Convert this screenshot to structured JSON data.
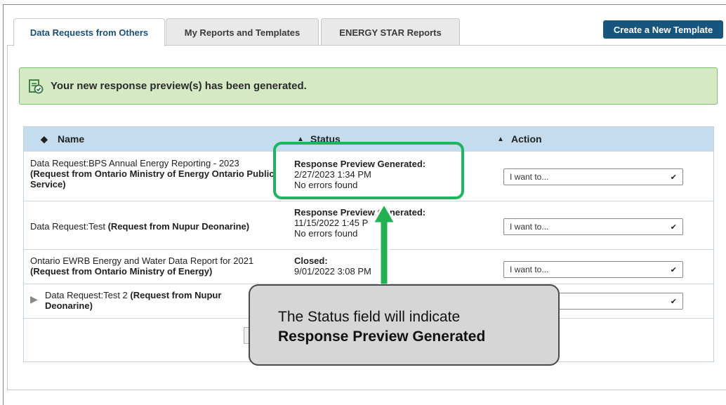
{
  "tabs": [
    {
      "label": "Data Requests from Others"
    },
    {
      "label": "My Reports and Templates"
    },
    {
      "label": "ENERGY STAR Reports"
    }
  ],
  "create_button": "Create a New Template",
  "alert": {
    "text": "Your new response preview(s) has been generated."
  },
  "table": {
    "headers": {
      "name": "Name",
      "status": "Status",
      "action": "Action"
    },
    "rows": [
      {
        "name_plain": "Data Request:BPS Annual Energy Reporting - 2023",
        "name_bold": "(Request from Ontario Ministry of Energy Ontario Public Service)",
        "status_title": "Response Preview Generated:",
        "status_date": "2/27/2023 1:34 PM",
        "status_note": "No errors found",
        "action": "I want to..."
      },
      {
        "name_plain": "Data Request:Test",
        "name_bold": "(Request from Nupur Deonarine)",
        "status_title": "Response Preview Generated:",
        "status_date": "11/15/2022 1:45 P",
        "status_note": "No errors found",
        "action": "I want to..."
      },
      {
        "name_plain": "Ontario EWRB Energy and Water Data Report for 2021",
        "name_bold": "(Request from Ontario Ministry of Energy)",
        "status_title": "Closed:",
        "status_date": "9/01/2022 3:08 PM",
        "status_note": "",
        "action": "I want to..."
      },
      {
        "name_plain": "Data Request:Test 2",
        "name_bold": "(Request from Nupur Deonarine)",
        "status_title": "",
        "status_date": "",
        "status_note": "",
        "action": ""
      }
    ]
  },
  "callout": {
    "line1": "The Status field will indicate",
    "line2": "Response Preview Generated"
  },
  "colors": {
    "accent": "#18557e",
    "highlight": "#1db560",
    "alert_bg": "#d4e9c4",
    "header_bg": "#c4dced"
  },
  "icons": [
    "check-document-icon",
    "sort-icon",
    "expand-arrow-icon",
    "chevron-down-icon",
    "up-arrow-icon"
  ]
}
